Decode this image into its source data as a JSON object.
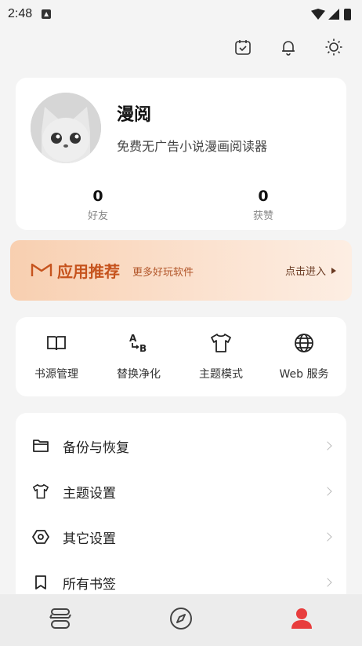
{
  "status_bar": {
    "time": "2:48"
  },
  "profile": {
    "name": "漫阅",
    "subtitle": "免费无广告小说漫画阅读器",
    "friends": {
      "count": "0",
      "label": "好友"
    },
    "likes": {
      "count": "0",
      "label": "获赞"
    }
  },
  "banner": {
    "title": "应用推荐",
    "subtitle": "更多好玩软件",
    "action": "点击进入"
  },
  "tools": [
    {
      "label": "书源管理",
      "icon": "book-open-icon"
    },
    {
      "label": "替换净化",
      "icon": "replace-ab-icon"
    },
    {
      "label": "主题模式",
      "icon": "shirt-icon"
    },
    {
      "label": "Web 服务",
      "icon": "globe-icon"
    }
  ],
  "menu": [
    {
      "label": "备份与恢复",
      "icon": "folder-icon"
    },
    {
      "label": "主题设置",
      "icon": "shirt-icon"
    },
    {
      "label": "其它设置",
      "icon": "settings-hex-icon"
    },
    {
      "label": "所有书签",
      "icon": "bookmark-icon"
    }
  ],
  "colors": {
    "accent": "#e83d3d",
    "banner_text": "#c6531d",
    "background": "#f4f4f4"
  }
}
